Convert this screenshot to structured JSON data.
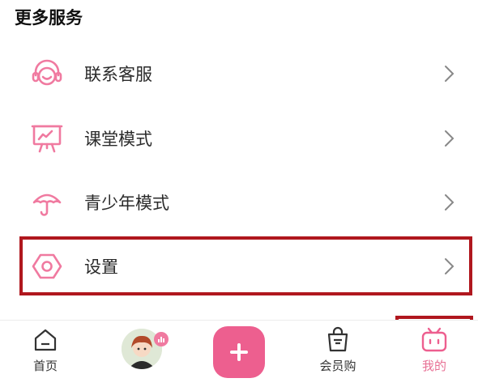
{
  "section": {
    "title": "更多服务"
  },
  "menu": {
    "items": [
      {
        "label": "联系客服",
        "icon": "headset-icon"
      },
      {
        "label": "课堂模式",
        "icon": "classroom-board-icon"
      },
      {
        "label": "青少年模式",
        "icon": "umbrella-icon"
      },
      {
        "label": "设置",
        "icon": "hexagon-settings-icon"
      }
    ]
  },
  "tabbar": {
    "tabs": [
      {
        "label": "首页",
        "icon": "home-icon"
      },
      {
        "label": "",
        "icon": "avatar"
      },
      {
        "label": "",
        "icon": "plus-icon"
      },
      {
        "label": "会员购",
        "icon": "shopping-bag-icon"
      },
      {
        "label": "我的",
        "icon": "tv-mascot-icon",
        "active": true
      }
    ]
  },
  "colors": {
    "accent": "#ed5f8f",
    "icon_pink": "#f07aa0",
    "highlight_red": "#b0171e"
  }
}
